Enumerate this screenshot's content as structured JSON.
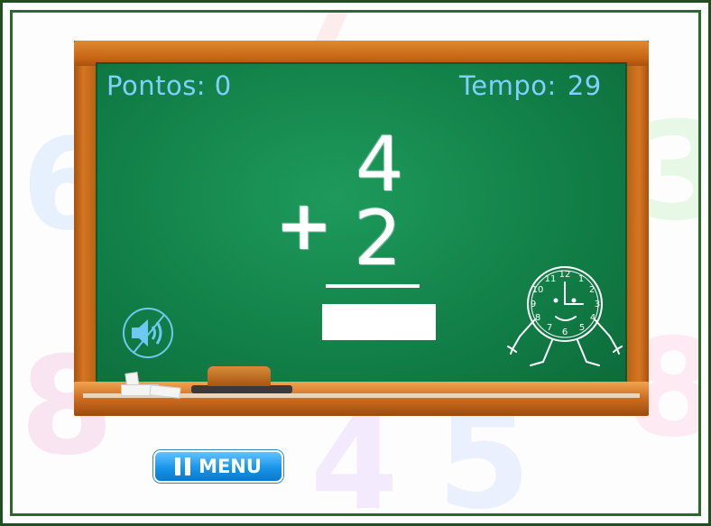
{
  "hud": {
    "score_label": "Pontos:",
    "score_value": "0",
    "time_label": "Tempo:",
    "time_value": "29"
  },
  "problem": {
    "operator": "+",
    "top_number": "4",
    "bottom_number": "2",
    "answer_value": ""
  },
  "controls": {
    "menu_label": "MENU",
    "sound_icon": "speaker-muted-icon",
    "pause_icon": "pause-icon"
  },
  "decor": {
    "clock_icon": "clock-character-icon",
    "clock_numbers": [
      "12",
      "1",
      "2",
      "3",
      "4",
      "5",
      "6",
      "7",
      "8",
      "9",
      "10",
      "11"
    ]
  },
  "colors": {
    "board_green": "#128048",
    "wood": "#c66514",
    "hud_text": "#7fd0ff",
    "menu_button": "#1895ea",
    "frame": "#2c6a2c"
  }
}
